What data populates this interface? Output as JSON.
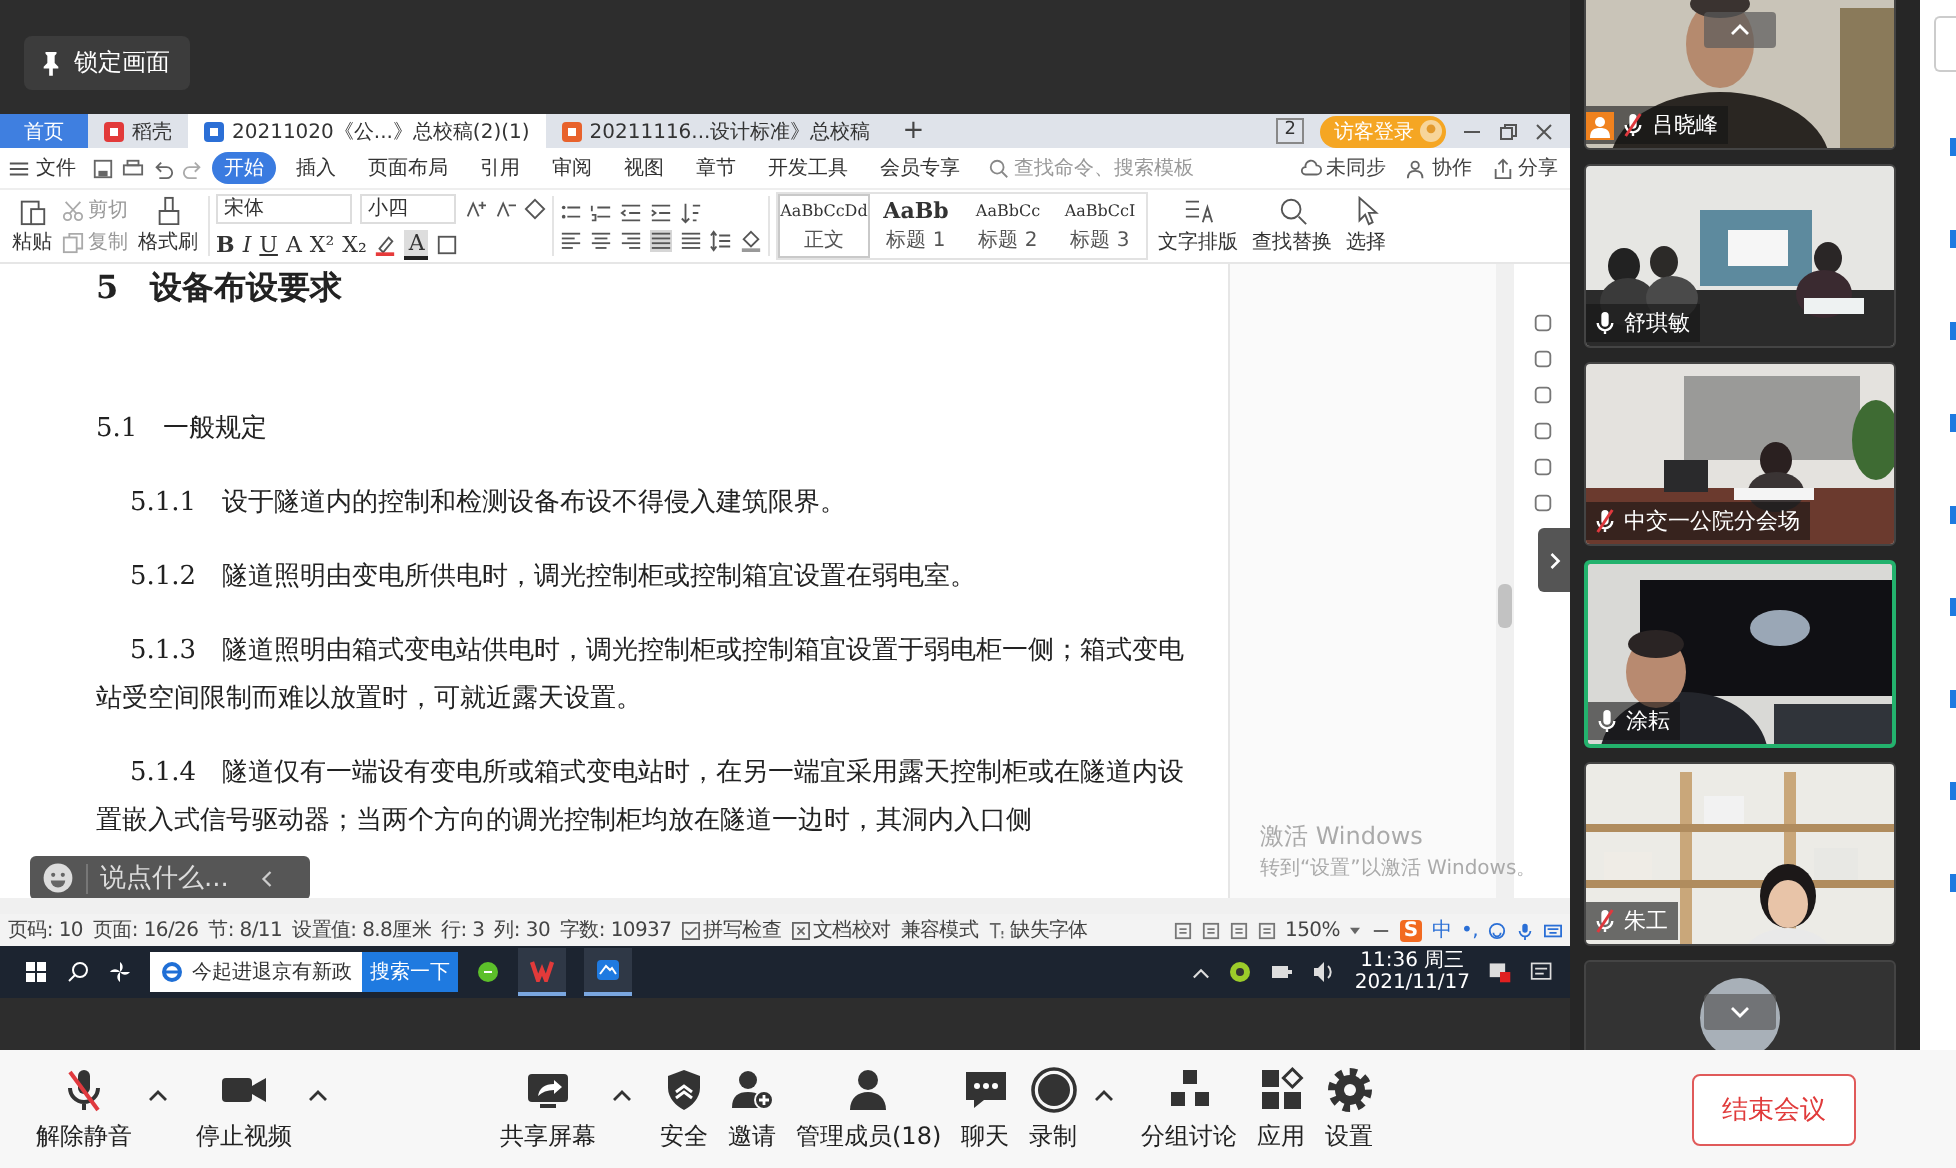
{
  "lock_button": "锁定画面",
  "wps": {
    "tabs": [
      {
        "label": "首页",
        "kind": "home",
        "selected": false
      },
      {
        "label": "稻壳",
        "kind": "docer",
        "selected": false
      },
      {
        "label": "20211020《公...》总校稿(2)(1)",
        "kind": "writer",
        "selected": true
      },
      {
        "label": "20211116...设计标准》总校稿",
        "kind": "presentation",
        "selected": false
      }
    ],
    "new_tab": "+",
    "window_count": "2",
    "login": "访客登录",
    "file_menu": "文件",
    "ribbon_tabs": [
      {
        "label": "开始",
        "selected": true
      },
      {
        "label": "插入",
        "selected": false
      },
      {
        "label": "页面布局",
        "selected": false
      },
      {
        "label": "引用",
        "selected": false
      },
      {
        "label": "审阅",
        "selected": false
      },
      {
        "label": "视图",
        "selected": false
      },
      {
        "label": "章节",
        "selected": false
      },
      {
        "label": "开发工具",
        "selected": false
      },
      {
        "label": "会员专享",
        "selected": false
      }
    ],
    "search_placeholder": "查找命令、搜索模板",
    "actions": [
      {
        "label": "未同步",
        "kind": "cloud"
      },
      {
        "label": "协作",
        "kind": "people"
      },
      {
        "label": "分享",
        "kind": "share"
      }
    ],
    "clipboard": {
      "paste": "粘贴",
      "cut": "剪切",
      "copy": "复制",
      "painter": "格式刷"
    },
    "font": "宋体",
    "size": "小四",
    "format_buttons": [
      "B",
      "I",
      "U",
      "A",
      "X²",
      "X₂"
    ],
    "font_color": "A",
    "align_buttons": [
      {
        "kind": "left",
        "selected": false
      },
      {
        "kind": "center",
        "selected": false
      },
      {
        "kind": "right",
        "selected": false
      },
      {
        "kind": "justify",
        "selected": true
      },
      {
        "kind": "distribute",
        "selected": false
      }
    ],
    "styles": [
      {
        "sample": "AaBbCcDd",
        "name": "正文",
        "kind": "body",
        "selected": true
      },
      {
        "sample": "AaBb",
        "name": "标题 1",
        "kind": "h1",
        "selected": false
      },
      {
        "sample": "AaBbCc",
        "name": "标题 2",
        "kind": "h2",
        "selected": false
      },
      {
        "sample": "AaBbCcI",
        "name": "标题 3",
        "kind": "h3",
        "selected": false
      }
    ],
    "tools": [
      {
        "label": "文字排版",
        "kind": "layout"
      },
      {
        "label": "查找替换",
        "kind": "find"
      },
      {
        "label": "选择",
        "kind": "select"
      }
    ],
    "document": {
      "heading": "5　设备布设要求",
      "blocks": [
        {
          "kind": "section",
          "text": "5.1　一般规定"
        },
        {
          "kind": "clause",
          "text": "5.1.1　设于隧道内的控制和检测设备布设不得侵入建筑限界。"
        },
        {
          "kind": "clause",
          "text": "5.1.2　隧道照明由变电所供电时，调光控制柜或控制箱宜设置在弱电室。"
        },
        {
          "kind": "clause",
          "text": "5.1.3　隧道照明由箱式变电站供电时，调光控制柜或控制箱宜设置于弱电柜一侧；箱式变电站受空间限制而难以放置时，可就近露天设置。"
        },
        {
          "kind": "clause",
          "text": "5.1.4　隧道仅有一端设有变电所或箱式变电站时，在另一端宜采用露天控制柜或在隧道内设置嵌入式信号驱动器；当两个方向的调光控制柜均放在隧道一边时，其洞内入口侧"
        }
      ]
    },
    "chat_placeholder": "说点什么...",
    "activation": {
      "title": "激活 Windows",
      "hint": "转到“设置”以激活 Windows。"
    },
    "status": [
      {
        "label": "页码: 10",
        "kind": "text"
      },
      {
        "label": "页面: 16/26",
        "kind": "text"
      },
      {
        "label": "节: 8/11",
        "kind": "text"
      },
      {
        "label": "设置值: 8.8厘米",
        "kind": "text"
      },
      {
        "label": "行: 3",
        "kind": "text"
      },
      {
        "label": "列: 30",
        "kind": "text"
      },
      {
        "label": "字数: 10937",
        "kind": "text"
      },
      {
        "label": "拼写检查",
        "kind": "check"
      },
      {
        "label": "文档校对",
        "kind": "proof"
      },
      {
        "label": "兼容模式",
        "kind": "text"
      },
      {
        "label": "缺失字体",
        "kind": "font"
      }
    ],
    "zoom": "150%",
    "ime": {
      "logo": "S",
      "mode": "中",
      "punct": "•,"
    }
  },
  "taskbar": {
    "search": "今起进退京有新政",
    "search_button": "搜索一下",
    "time": "11:36 周三",
    "date": "2021/11/17"
  },
  "participants": [
    {
      "name": "吕晓峰",
      "muted": true,
      "speaking": false,
      "host": true
    },
    {
      "name": "舒琪敏",
      "muted": false,
      "speaking": false,
      "host": false
    },
    {
      "name": "中交一公院分会场",
      "muted": true,
      "speaking": false,
      "host": false
    },
    {
      "name": "涂耘",
      "muted": false,
      "speaking": true,
      "host": false
    },
    {
      "name": "朱工",
      "muted": true,
      "speaking": false,
      "host": false
    }
  ],
  "toolbar": {
    "audio": {
      "label": "解除静音",
      "muted": true,
      "caret": true
    },
    "video": {
      "label": "停止视频",
      "caret": true
    },
    "items": [
      {
        "label": "共享屏幕",
        "kind": "share",
        "caret": true
      },
      {
        "label": "安全",
        "kind": "security",
        "caret": false
      },
      {
        "label": "邀请",
        "kind": "invite",
        "caret": false
      },
      {
        "label": "管理成员(18)",
        "kind": "members",
        "caret": false
      },
      {
        "label": "聊天",
        "kind": "chat",
        "caret": false
      },
      {
        "label": "录制",
        "kind": "record",
        "caret": true
      },
      {
        "label": "分组讨论",
        "kind": "breakout",
        "caret": false
      },
      {
        "label": "应用",
        "kind": "apps",
        "caret": false
      },
      {
        "label": "设置",
        "kind": "settings",
        "caret": false
      }
    ],
    "end_button": "结束会议"
  }
}
